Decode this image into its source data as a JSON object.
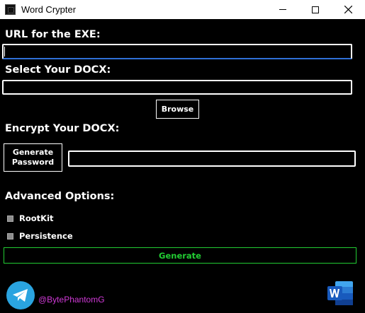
{
  "window": {
    "title": "Word Crypter",
    "min_label": "minimize",
    "max_label": "maximize",
    "close_label": "close"
  },
  "form": {
    "url_label": "URL for the EXE:",
    "url_value": "",
    "select_label": "Select Your DOCX:",
    "docx_value": "",
    "browse_label": "Browse",
    "encrypt_label": "Encrypt Your DOCX:",
    "genpass_line1": "Generate",
    "genpass_line2": "Password",
    "password_value": ""
  },
  "advanced": {
    "title": "Advanced Options:",
    "options": [
      {
        "label": "RootKit",
        "checked": false
      },
      {
        "label": "Persistence",
        "checked": false
      }
    ]
  },
  "actions": {
    "generate_label": "Generate"
  },
  "footer": {
    "handle": "@BytePhantomG"
  },
  "colors": {
    "background": "#000000",
    "generate_accent": "#22cc33",
    "handle_color": "#d13ad8",
    "telegram_blue": "#2aa4e0",
    "word_blue": "#185abd"
  }
}
